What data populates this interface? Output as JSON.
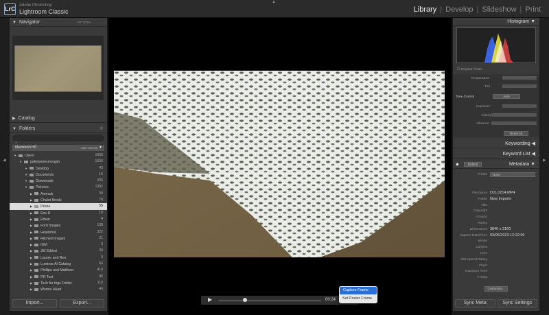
{
  "app": {
    "brand_small": "Adobe Photoshop",
    "brand_name": "Lightroom Classic",
    "logo": "LrC"
  },
  "modules": [
    "Library",
    "Develop",
    "Slideshow",
    "Print"
  ],
  "left": {
    "navigator": {
      "title": "Navigator",
      "zoom": "FIT 100%"
    },
    "catalog": {
      "title": "Catalog"
    },
    "folders": {
      "title": "Folders",
      "volume": "Macintosh HD",
      "volume_space": "620 / 994 GB"
    },
    "tree": [
      {
        "name": "Users",
        "count": "1656",
        "indent": 0,
        "sel": false
      },
      {
        "name": "peterjamesmorgan",
        "count": "1656",
        "indent": 1,
        "sel": false
      },
      {
        "name": "Desktop",
        "count": "43",
        "indent": 2,
        "sel": false
      },
      {
        "name": "Documents",
        "count": "16",
        "indent": 2,
        "sel": false
      },
      {
        "name": "Downloads",
        "count": "205",
        "indent": 2,
        "sel": false
      },
      {
        "name": "Pictures",
        "count": "1392",
        "indent": 2,
        "sel": false
      },
      {
        "name": "Animals",
        "count": "30",
        "indent": 3,
        "sel": false
      },
      {
        "name": "Chalet Nicole",
        "count": "70",
        "indent": 3,
        "sel": false
      },
      {
        "name": "Drone",
        "count": "55",
        "indent": 3,
        "sel": true
      },
      {
        "name": "Eos-R",
        "count": "18",
        "indent": 3,
        "sel": false
      },
      {
        "name": "Ethan",
        "count": "4",
        "indent": 3,
        "sel": false
      },
      {
        "name": "Ford Images",
        "count": "108",
        "indent": 3,
        "sel": false
      },
      {
        "name": "Headshot",
        "count": "322",
        "indent": 3,
        "sel": false
      },
      {
        "name": "Hitched Images",
        "count": "21",
        "indent": 3,
        "sel": false
      },
      {
        "name": "IOM",
        "count": "3",
        "indent": 3,
        "sel": false
      },
      {
        "name": "JW Edited",
        "count": "39",
        "indent": 3,
        "sel": false
      },
      {
        "name": "Lauren and Ron",
        "count": "3",
        "indent": 3,
        "sel": false
      },
      {
        "name": "Luminar AI Catalog",
        "count": "64",
        "indent": 3,
        "sel": false
      },
      {
        "name": "Phillipa and Matthew",
        "count": "410",
        "indent": 3,
        "sel": false
      },
      {
        "name": "RR Test",
        "count": "86",
        "indent": 3,
        "sel": false
      },
      {
        "name": "Tech for togs Folder",
        "count": "110",
        "indent": 3,
        "sel": false
      },
      {
        "name": "Worms Head",
        "count": "43",
        "indent": 3,
        "sel": false
      }
    ],
    "import_label": "Import...",
    "export_label": "Export..."
  },
  "center": {
    "time": "00:24",
    "popup": {
      "item1": "Capture Frame",
      "item2": "Set Poster Frame"
    }
  },
  "right": {
    "histogram_title": "Histogram",
    "original_photo": "Original Photo",
    "temperature": "Temperature",
    "tint": "Tint",
    "tone_control": "Tone Control",
    "auto": "Auto",
    "exposure": "Exposure",
    "clarity": "Clarity",
    "vibrance": "Vibrance",
    "reset_all": "Reset All",
    "keywording": "Keywording",
    "keyword_list": "Keyword List",
    "metadata": "Metadata",
    "meta_preset_default": "Default",
    "preset_label": "Preset",
    "preset_value": "None",
    "fields": [
      {
        "label": "File Name",
        "value": "DJI_0214.MP4"
      },
      {
        "label": "Folder",
        "value": "New Imports"
      },
      {
        "label": "Title",
        "value": ""
      },
      {
        "label": "Copyright",
        "value": ""
      },
      {
        "label": "Creator",
        "value": ""
      },
      {
        "label": "Rating",
        "value": ""
      },
      {
        "label": "Dimensions",
        "value": "3840 x 2160"
      },
      {
        "label": "Capture Date/Time",
        "value": "03/05/2023 12:22:09"
      },
      {
        "label": "Model",
        "value": ""
      },
      {
        "label": "Camera",
        "value": ""
      },
      {
        "label": "Lens",
        "value": ""
      },
      {
        "label": "ISO Speed Rating",
        "value": ""
      },
      {
        "label": "Flash",
        "value": ""
      },
      {
        "label": "Exposure Time",
        "value": ""
      },
      {
        "label": "F-Stop",
        "value": ""
      }
    ],
    "customize": "Customize...",
    "sync_meta": "Sync Meta",
    "sync_settings": "Sync Settings"
  }
}
